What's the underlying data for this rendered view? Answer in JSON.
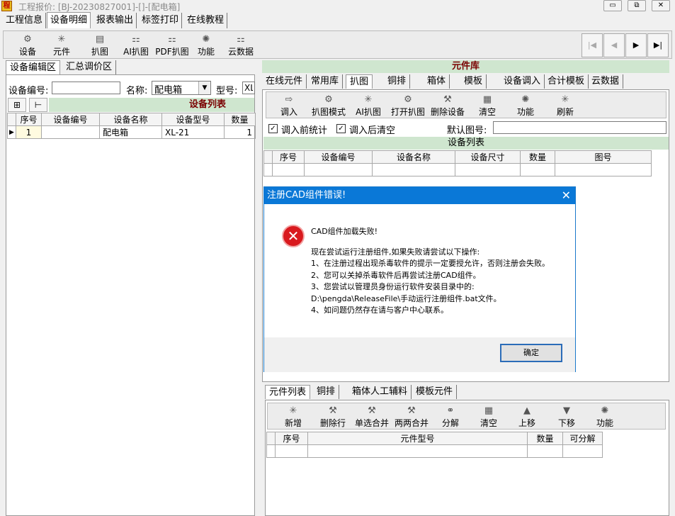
{
  "window": {
    "title": "工程报价: [BJ-20230827001]-[]-[配电箱]",
    "minimize": "▭",
    "restore": "⧉",
    "close": "✕",
    "app_icon": "程"
  },
  "main_tabs": [
    "工程信息",
    "设备明细",
    "报表输出",
    "标签打印",
    "在线教程"
  ],
  "toolbar": {
    "items": [
      {
        "label": "设备",
        "icon": "device-icon"
      },
      {
        "label": "元件",
        "icon": "component-icon"
      },
      {
        "label": "扒图",
        "icon": "extract-icon"
      },
      {
        "label": "AI扒图",
        "icon": "ai-extract-icon"
      },
      {
        "label": "PDF扒图",
        "icon": "pdf-extract-icon"
      },
      {
        "label": "功能",
        "icon": "function-icon"
      },
      {
        "label": "云数据",
        "icon": "cloud-data-icon"
      }
    ],
    "nav": [
      "|◀",
      "◀",
      "▶",
      "▶|"
    ]
  },
  "left": {
    "tabs": [
      "设备编辑区",
      "汇总调价区"
    ],
    "device_no_label": "设备编号:",
    "name_label": "名称:",
    "name_value": "配电箱",
    "model_label": "型号:",
    "model_value": "XL",
    "list_title": "设备列表",
    "columns": [
      "序号",
      "设备编号",
      "设备名称",
      "设备型号",
      "数量"
    ],
    "rows": [
      {
        "seq": "1",
        "no": "",
        "name": "配电箱",
        "model": "XL-21",
        "qty": "1"
      }
    ]
  },
  "right": {
    "header": "元件库",
    "tabs": [
      "在线元件",
      "常用库",
      "扒图",
      "铜排",
      "箱体",
      "模板",
      "设备调入",
      "合计模板",
      "云数据"
    ],
    "toolbar": [
      "调入",
      "扒图模式",
      "AI扒图",
      "打开扒图",
      "删除设备",
      "清空",
      "功能",
      "刷新"
    ],
    "check1": "调入前统计",
    "check2": "调入后清空",
    "default_fig_label": "默认图号:",
    "list_title": "设备列表",
    "columns": [
      "序号",
      "设备编号",
      "设备名称",
      "设备尺寸",
      "数量",
      "图号"
    ]
  },
  "bottom": {
    "tabs": [
      "元件列表",
      "铜排",
      "箱体人工辅料",
      "模板元件"
    ],
    "toolbar": [
      "新增",
      "删除行",
      "单选合并",
      "两两合并",
      "分解",
      "清空",
      "上移",
      "下移",
      "功能"
    ],
    "columns": [
      "序号",
      "元件型号",
      "数量",
      "可分解"
    ]
  },
  "dialog": {
    "title": "注册CAD组件错误!",
    "close": "✕",
    "icon": "✕",
    "lines": [
      "CAD组件加载失败!",
      "",
      "现在尝试运行注册组件,如果失败请尝试以下操作:",
      "1、在注册过程出现杀毒软件的提示一定要授允许，否则注册会失败。",
      "2、您可以关掉杀毒软件后再尝试注册CAD组件。",
      "3、您尝试以管理员身份运行软件安装目录中的:",
      "D:\\pengda\\ReleaseFile\\手动运行注册组件.bat文件。",
      "4、如问题仍然存在请与客户中心联系。"
    ],
    "ok": "确定"
  }
}
